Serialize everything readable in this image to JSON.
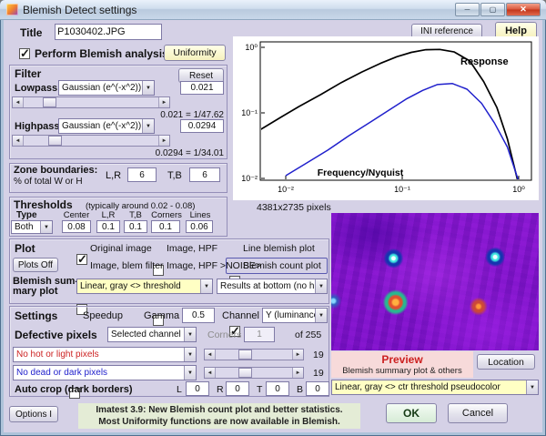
{
  "window": {
    "title": "Blemish Detect settings",
    "minimize_icon": "─",
    "maximize_icon": "▢",
    "close_icon": "✕"
  },
  "header": {
    "title_label": "Title",
    "title_value": "P1030402.JPG",
    "ini_reference_button": "INI reference",
    "help_button": "Help"
  },
  "analysis": {
    "label": "Perform Blemish analysis",
    "checked": true,
    "uniformity_button": "Uniformity"
  },
  "filter": {
    "label": "Filter",
    "reset_button": "Reset",
    "lowpass_label": "Lowpass",
    "lowpass_type": "Gaussian (e^(-x^2))",
    "lowpass_value": "0.021",
    "lowpass_note": "0.021 = 1/47.62",
    "highpass_label": "Highpass",
    "highpass_type": "Gaussian (e^(-x^2))",
    "highpass_value": "0.0294",
    "highpass_note": "0.0294 = 1/34.01"
  },
  "zone": {
    "label": "Zone boundaries:",
    "sublabel": "% of total W or H",
    "lr_label": "L,R",
    "lr_value": "6",
    "tb_label": "T,B",
    "tb_value": "6"
  },
  "thresholds": {
    "label": "Thresholds",
    "hint": "(typically around 0.02 - 0.08)",
    "type_label": "Type",
    "type_value": "Both",
    "columns": [
      "Center",
      "L,R",
      "T,B",
      "Corners",
      "Lines"
    ],
    "values": [
      "0.08",
      "0.1",
      "0.1",
      "0.1",
      "0.06"
    ]
  },
  "plot": {
    "label": "Plot",
    "plots_off_button": "Plots Off",
    "checkboxes": [
      {
        "label": "Original image",
        "checked": true
      },
      {
        "label": "Image, HPF",
        "checked": false
      },
      {
        "label": "Line blemish plot",
        "checked": false
      },
      {
        "label": "Image, blem filter",
        "checked": false
      },
      {
        "label": "Image, HPF >NOISE>",
        "checked": false
      },
      {
        "label": "Blemish count plot",
        "checked": true
      }
    ],
    "summary_label_line1": "Blemish sum-",
    "summary_label_line2": "mary plot",
    "summary_value": "Linear, gray <> threshold",
    "results_value": "Results at bottom (no histogram)"
  },
  "settings": {
    "label": "Settings",
    "speedup_label": "Speedup",
    "speedup_checked": false,
    "gamma_label": "Gamma",
    "gamma_value": "0.5",
    "channel_label": "Channel",
    "channel_value": "Y (luminance)"
  },
  "defective": {
    "label": "Defective pixels",
    "channel_value": "Selected channel",
    "corners_label": "Corners",
    "corners_value": "1",
    "of_label": "of 255",
    "hot_value": "No hot or light pixels",
    "hot_level": "19",
    "dead_value": "No dead or dark pixels",
    "dead_level": "19"
  },
  "autocrop": {
    "label": "Auto crop (dark borders)",
    "l_label": "L",
    "l_value": "0",
    "r_label": "R",
    "r_value": "0",
    "t_label": "T",
    "t_value": "0",
    "b_label": "B",
    "b_value": "0"
  },
  "footer": {
    "options_button": "Options I",
    "note_line1": "Imatest 3.9: New Blemish count plot and better statistics.",
    "note_line2": "Most Uniformity functions are now available in Blemish.",
    "ok_button": "OK",
    "cancel_button": "Cancel"
  },
  "preview": {
    "pixels_label": "4381x2735 pixels",
    "title": "Preview",
    "location_button": "Location",
    "caption": "Blemish summary plot & others",
    "display_value": "Linear, gray <> ctr threshold  pseudocolor",
    "accent_color": "#cc2020"
  },
  "chart_data": {
    "type": "line",
    "title": "",
    "xlabel": "Frequency/Nyquist",
    "ylabel": "",
    "annotation": "Response",
    "x_scale": "log",
    "y_scale": "log",
    "x_ticks": [
      "10⁻²",
      "10⁻¹",
      "10⁰"
    ],
    "y_ticks": [
      "10⁰",
      "10⁻¹",
      "10⁻²"
    ],
    "xlim": [
      0.006,
      1.2
    ],
    "ylim": [
      0.009,
      1.2
    ],
    "grid": false,
    "legend": "none",
    "series": [
      {
        "name": "combined-filter-response-black",
        "color": "#000000",
        "x": [
          0.006,
          0.009,
          0.013,
          0.02,
          0.03,
          0.045,
          0.065,
          0.09,
          0.12,
          0.16,
          0.21,
          0.28,
          0.38,
          0.5,
          0.65,
          0.8,
          1.0
        ],
        "y": [
          0.055,
          0.085,
          0.125,
          0.19,
          0.29,
          0.42,
          0.57,
          0.72,
          0.84,
          0.92,
          0.93,
          0.85,
          0.62,
          0.3,
          0.12,
          0.04,
          0.008
        ]
      },
      {
        "name": "highpass-response-blue",
        "color": "#2020cc",
        "x": [
          0.01,
          0.015,
          0.023,
          0.035,
          0.055,
          0.08,
          0.11,
          0.15,
          0.2,
          0.27,
          0.36,
          0.48,
          0.62,
          0.8,
          1.0
        ],
        "y": [
          0.011,
          0.017,
          0.027,
          0.045,
          0.075,
          0.115,
          0.165,
          0.22,
          0.27,
          0.28,
          0.23,
          0.14,
          0.07,
          0.03,
          0.009
        ]
      }
    ]
  }
}
